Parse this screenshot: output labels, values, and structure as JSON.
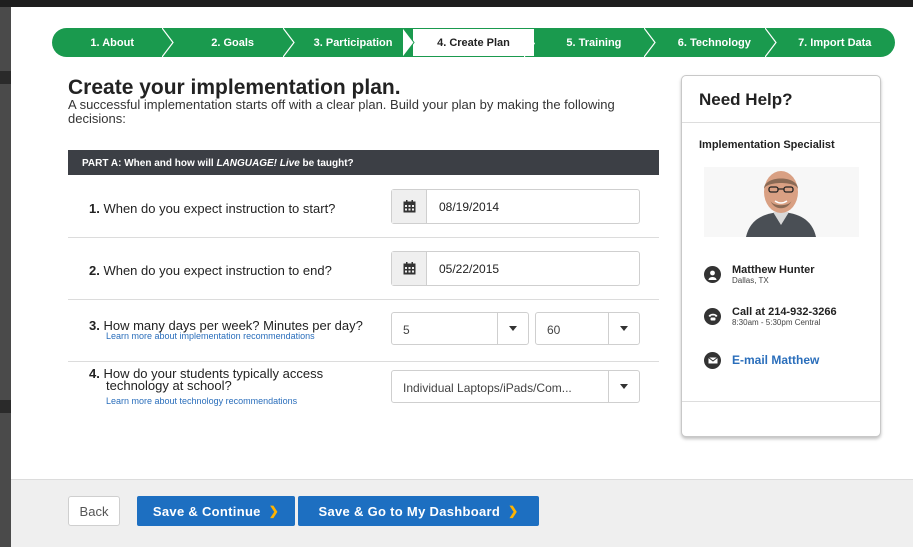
{
  "wizard": {
    "steps": [
      {
        "label": "1. About"
      },
      {
        "label": "2. Goals"
      },
      {
        "label": "3. Participation"
      },
      {
        "label": "4. Create Plan"
      },
      {
        "label": "5. Training"
      },
      {
        "label": "6. Technology"
      },
      {
        "label": "7. Import Data"
      }
    ],
    "active_index": 3,
    "accent_color": "#1a9a4e"
  },
  "main": {
    "title": "Create your implementation plan.",
    "intro": "A successful implementation starts off with a clear plan. Build your plan by making the following decisions:",
    "part_a": {
      "prefix": "PART A: When and how will ",
      "product": "LANGUAGE! Live",
      "suffix": " be taught?"
    },
    "questions": [
      {
        "num": "1.",
        "text": " When do you expect instruction to start?",
        "value": "08/19/2014",
        "icon": "calendar-icon"
      },
      {
        "num": "2.",
        "text": " When do you expect instruction to end?",
        "value": "05/22/2015",
        "icon": "calendar-icon"
      },
      {
        "num": "3.",
        "text": " How many days per week? Minutes per day?",
        "link": "Learn more about implementation recommendations",
        "days": "5",
        "minutes": "60"
      },
      {
        "num": "4.",
        "text_line1": " How do your students typically access",
        "text_line2": "technology at school?",
        "link": "Learn more about technology recommendations",
        "value": "Individual Laptops/iPads/Com..."
      }
    ]
  },
  "help": {
    "title": "Need Help?",
    "specialist_label": "Implementation Specialist",
    "name": "Matthew Hunter",
    "location": "Dallas, TX",
    "call_prefix": "Call at ",
    "phone": "214-932-3266",
    "hours": "8:30am - 5:30pm Central",
    "email_label": "E-mail Matthew"
  },
  "footer": {
    "back_label": "Back",
    "save_continue_label": "Save & Continue",
    "save_dashboard_label": "Save & Go to My Dashboard",
    "primary_color": "#1d6fc1"
  }
}
